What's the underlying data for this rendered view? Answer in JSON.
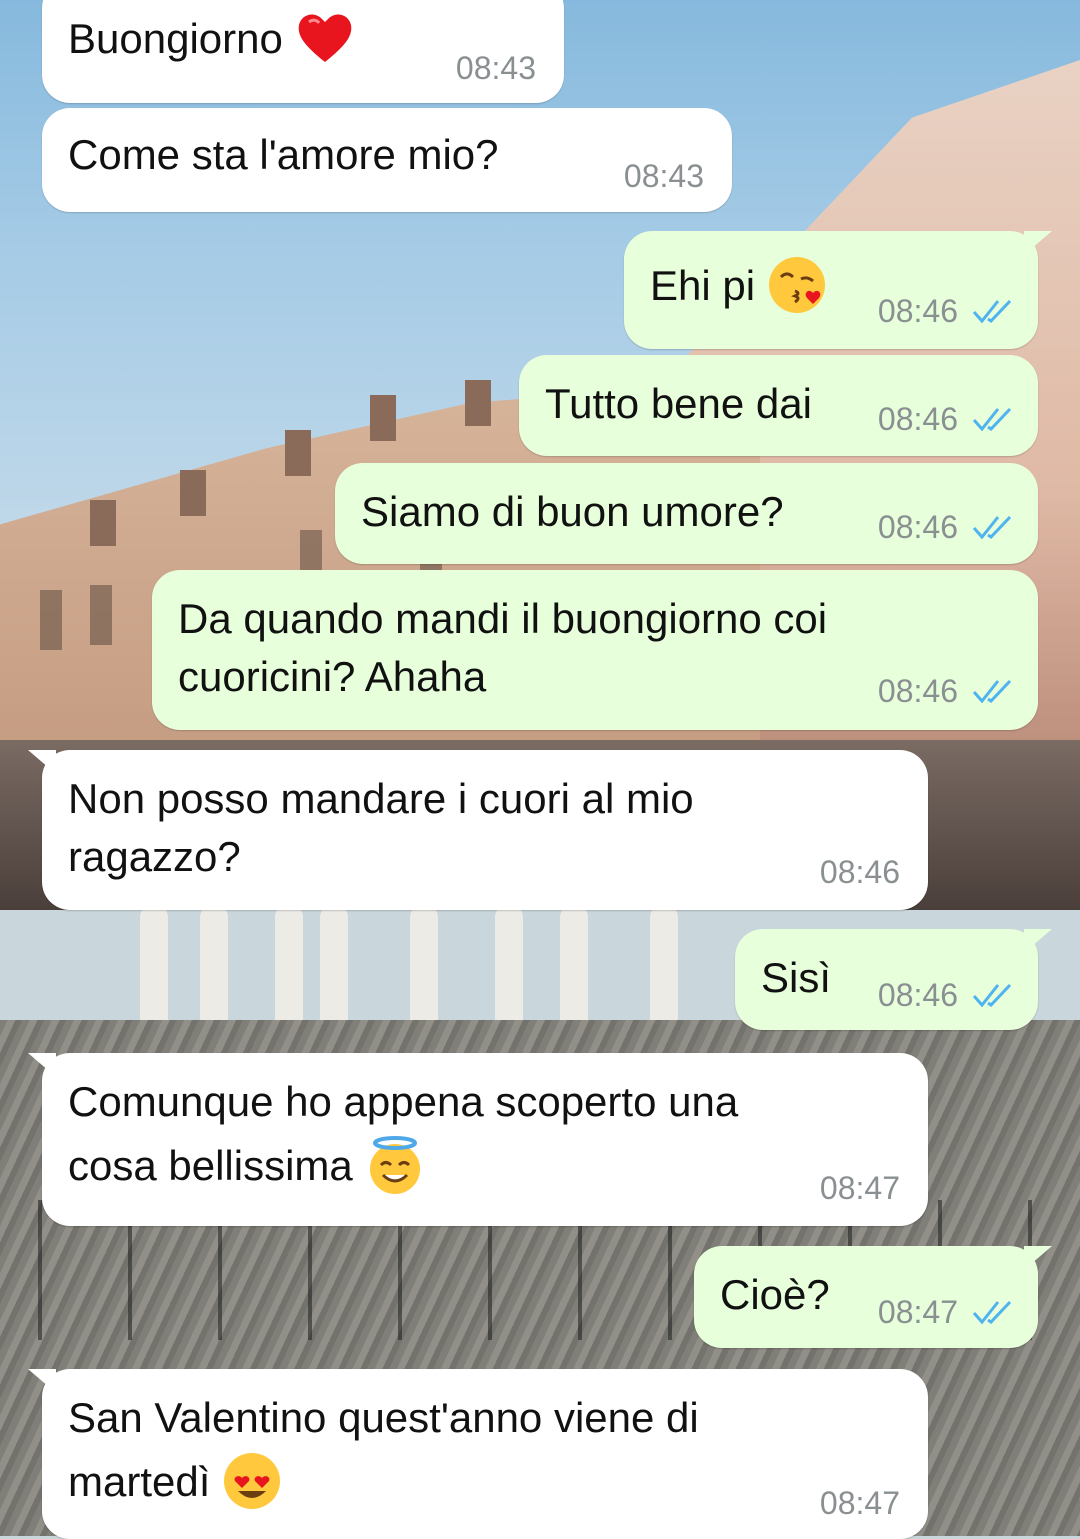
{
  "messages": [
    {
      "direction": "in",
      "text": "Buongiorno",
      "emoji": "red-heart",
      "time": "08:43"
    },
    {
      "direction": "in",
      "text": "Come sta l'amore mio?",
      "time": "08:43"
    },
    {
      "direction": "out",
      "text": "Ehi pi",
      "emoji": "face-blowing-kiss",
      "time": "08:46",
      "status": "read"
    },
    {
      "direction": "out",
      "text": "Tutto bene dai",
      "time": "08:46",
      "status": "read"
    },
    {
      "direction": "out",
      "text": "Siamo di buon umore?",
      "time": "08:46",
      "status": "read"
    },
    {
      "direction": "out",
      "text_line1": "Da quando mandi il buongiorno coi",
      "text_line2": "cuoricini? Ahaha",
      "time": "08:46",
      "status": "read"
    },
    {
      "direction": "in",
      "text_line1": "Non posso mandare i cuori al mio",
      "text_line2": "ragazzo?",
      "time": "08:46"
    },
    {
      "direction": "out",
      "text": "Sisì",
      "time": "08:46",
      "status": "read"
    },
    {
      "direction": "in",
      "text_line1": "Comunque ho appena scoperto una",
      "text_line2": "cosa bellissima",
      "emoji": "smiling-face-with-halo",
      "time": "08:47"
    },
    {
      "direction": "out",
      "text": "Cioè?",
      "time": "08:47",
      "status": "read"
    },
    {
      "direction": "in",
      "text_line1": "San Valentino quest'anno viene di",
      "text_line2": "martedì",
      "emoji": "smiling-face-with-heart-eyes",
      "time": "08:47"
    }
  ],
  "colors": {
    "incoming_bubble": "#ffffff",
    "outgoing_bubble": "#e7ffdb",
    "timestamp": "#8a8f92",
    "read_ticks": "#4fb3f0"
  },
  "icons": {
    "read_receipt": "double-check-icon"
  }
}
